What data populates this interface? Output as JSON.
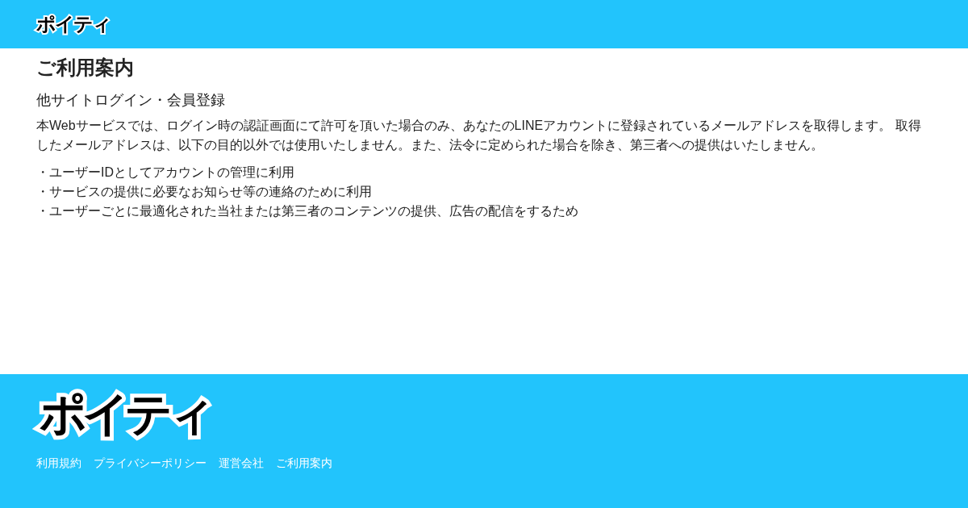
{
  "header": {
    "logo": "ポイティ"
  },
  "title": "ご利用案内",
  "section": {
    "heading": "他サイトログイン・会員登録",
    "paragraph": "本Webサービスでは、ログイン時の認証画面にて許可を頂いた場合のみ、あなたのLINEアカウントに登録されているメールアドレスを取得します。 取得したメールアドレスは、以下の目的以外では使用いたしません。また、法令に定められた場合を除き、第三者への提供はいたしません。",
    "list": [
      "・ユーザーIDとしてアカウントの管理に利用",
      "・サービスの提供に必要なお知らせ等の連絡のために利用",
      "・ユーザーごとに最適化された当社または第三者のコンテンツの提供、広告の配信をするため"
    ]
  },
  "footer": {
    "logo": "ポイティ",
    "links": [
      "利用規約",
      "プライバシーポリシー",
      "運営会社",
      "ご利用案内"
    ]
  }
}
